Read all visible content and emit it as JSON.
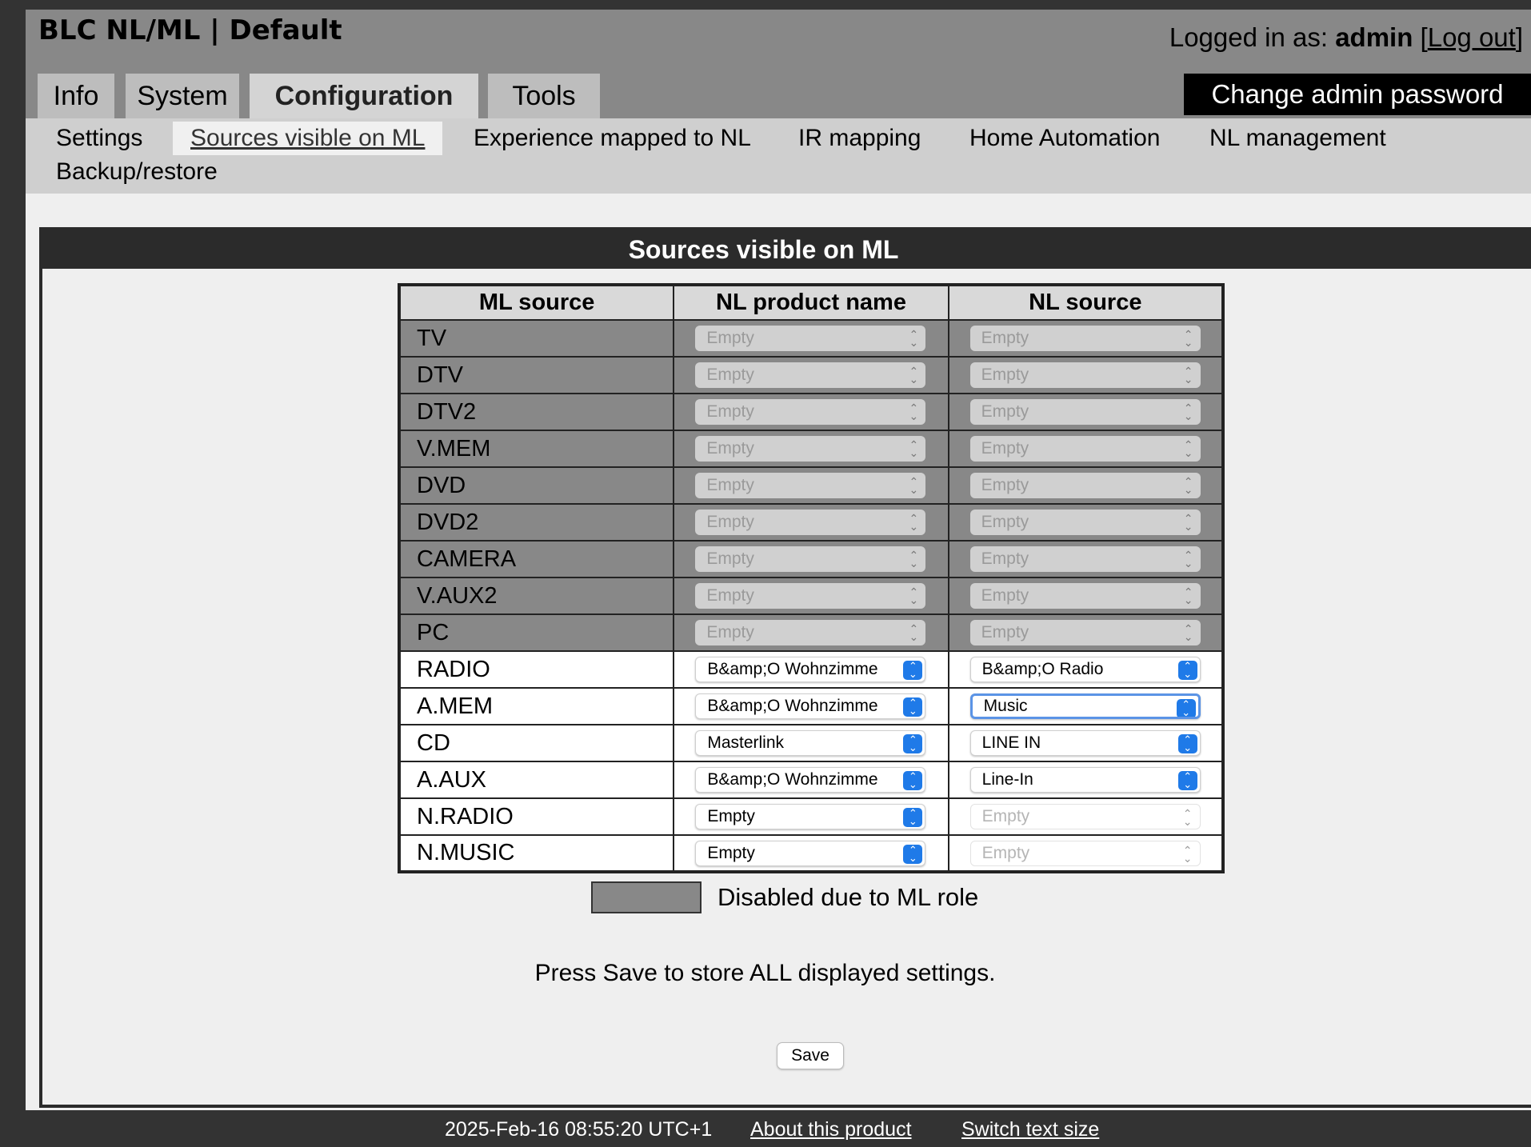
{
  "app": {
    "title": "BLC NL/ML | Default",
    "login_prefix": "Logged in as: ",
    "user": "admin",
    "logout_label": "Log out",
    "change_password_label": "Change admin password"
  },
  "tabs": [
    {
      "label": "Info"
    },
    {
      "label": "System"
    },
    {
      "label": "Configuration",
      "active": true
    },
    {
      "label": "Tools"
    }
  ],
  "subnav": [
    {
      "label": "Settings"
    },
    {
      "label": "Sources visible on ML",
      "active": true
    },
    {
      "label": "Experience mapped to NL"
    },
    {
      "label": "IR mapping"
    },
    {
      "label": "Home Automation"
    },
    {
      "label": "NL management"
    },
    {
      "label": "Backup/restore"
    }
  ],
  "panel": {
    "title": "Sources visible on ML",
    "columns": [
      "ML source",
      "NL product name",
      "NL source"
    ],
    "rows": [
      {
        "ml_source": "TV",
        "product": "Empty",
        "nl_source": "Empty"
      },
      {
        "ml_source": "DTV",
        "product": "Empty",
        "nl_source": "Empty"
      },
      {
        "ml_source": "DTV2",
        "product": "Empty",
        "nl_source": "Empty"
      },
      {
        "ml_source": "V.MEM",
        "product": "Empty",
        "nl_source": "Empty"
      },
      {
        "ml_source": "DVD",
        "product": "Empty",
        "nl_source": "Empty"
      },
      {
        "ml_source": "DVD2",
        "product": "Empty",
        "nl_source": "Empty"
      },
      {
        "ml_source": "CAMERA",
        "product": "Empty",
        "nl_source": "Empty"
      },
      {
        "ml_source": "V.AUX2",
        "product": "Empty",
        "nl_source": "Empty"
      },
      {
        "ml_source": "PC",
        "product": "Empty",
        "nl_source": "Empty"
      },
      {
        "ml_source": "RADIO",
        "product": "B&amp;O Wohnzimme",
        "nl_source": "B&amp;O Radio"
      },
      {
        "ml_source": "A.MEM",
        "product": "B&amp;O Wohnzimme",
        "nl_source": "Music"
      },
      {
        "ml_source": "CD",
        "product": "Masterlink",
        "nl_source": "LINE IN"
      },
      {
        "ml_source": "A.AUX",
        "product": "B&amp;O Wohnzimme",
        "nl_source": "Line-In"
      },
      {
        "ml_source": "N.RADIO",
        "product": "Empty",
        "nl_source": "Empty"
      },
      {
        "ml_source": "N.MUSIC",
        "product": "Empty",
        "nl_source": "Empty"
      }
    ],
    "legend_label": "Disabled due to ML role",
    "hint": "Press Save to store ALL displayed settings.",
    "save_label": "Save"
  },
  "footer": {
    "timestamp": "2025-Feb-16 08:55:20 UTC+1",
    "about_label": "About this product",
    "text_size_label": "Switch text size"
  },
  "colors": {
    "disabled_row": "#888888",
    "accent": "#1f7ae8",
    "panel_header": "#2b2b2b"
  }
}
